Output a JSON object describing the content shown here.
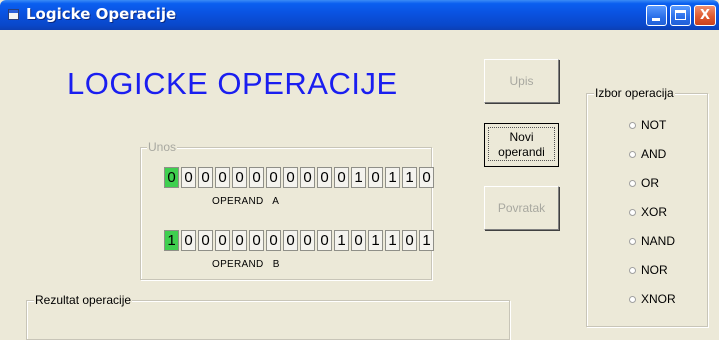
{
  "window": {
    "title": "Logicke Operacije",
    "buttons": {
      "minimize": "_",
      "maximize": "□",
      "close": "X"
    }
  },
  "main": {
    "heading": "LOGICKE OPERACIJE",
    "buttons": {
      "upis": "Upis",
      "novi_line1": "Novi",
      "novi_line2": "operandi",
      "povratak": "Povratak"
    },
    "unos": {
      "legend": "Unos",
      "operand_a": {
        "label": "OPERAND   A",
        "bits": [
          "0",
          "0",
          "0",
          "0",
          "0",
          "0",
          "0",
          "0",
          "0",
          "0",
          "0",
          "1",
          "0",
          "1",
          "1",
          "0"
        ],
        "highlight_index": 0
      },
      "operand_b": {
        "label": "OPERAND   B",
        "bits": [
          "1",
          "0",
          "0",
          "0",
          "0",
          "0",
          "0",
          "0",
          "0",
          "0",
          "1",
          "0",
          "1",
          "1",
          "0",
          "1"
        ],
        "highlight_index": 0
      }
    },
    "izbor": {
      "legend": "Izbor operacija",
      "options": [
        "NOT",
        "AND",
        "OR",
        "XOR",
        "NAND",
        "NOR",
        "XNOR"
      ]
    },
    "rezultat": {
      "legend": "Rezultat operacije"
    }
  },
  "colors": {
    "heading": "#1a1ef0",
    "bit_highlight": "#3fcf4f",
    "titlebar": "#0a52e0"
  }
}
